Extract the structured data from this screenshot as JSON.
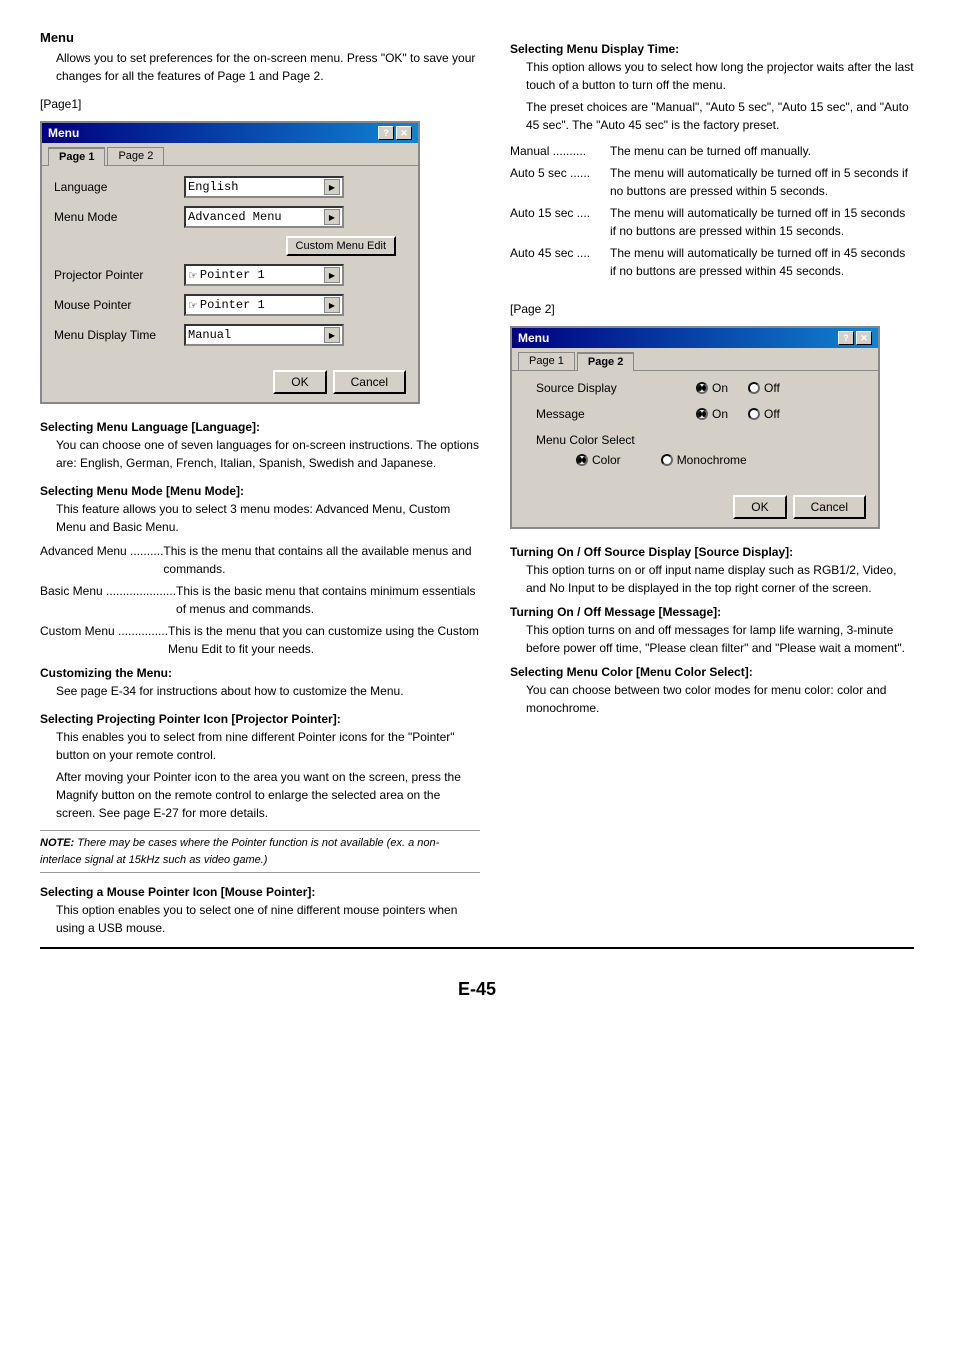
{
  "header": {
    "menu_heading": "Menu",
    "menu_desc": "Allows you to set preferences for the on-screen menu. Press \"OK\" to save your changes for all the features of Page 1 and Page 2.",
    "page1_label": "[Page1]",
    "page2_label": "[Page 2]"
  },
  "dialog1": {
    "title": "Menu",
    "tab1": "Page 1",
    "tab2": "Page 2",
    "rows": [
      {
        "label": "Language",
        "value": "English",
        "type": "select"
      },
      {
        "label": "Menu Mode",
        "value": "Advanced Menu",
        "type": "select"
      },
      {
        "label": "Projector Pointer",
        "value": "Pointer 1",
        "type": "select"
      },
      {
        "label": "Mouse Pointer",
        "value": "Pointer 1",
        "type": "select"
      },
      {
        "label": "Menu Display Time",
        "value": "Manual",
        "type": "select"
      }
    ],
    "custom_btn": "Custom Menu Edit",
    "ok_btn": "OK",
    "cancel_btn": "Cancel"
  },
  "dialog2": {
    "title": "Menu",
    "tab1": "Page 1",
    "tab2": "Page 2",
    "rows": [
      {
        "label": "Source Display",
        "on_selected": true,
        "off_selected": false
      },
      {
        "label": "Message",
        "on_selected": true,
        "off_selected": false
      }
    ],
    "color_label": "Menu Color Select",
    "color_selected": true,
    "mono_selected": false,
    "ok_btn": "OK",
    "cancel_btn": "Cancel"
  },
  "left_sections": [
    {
      "heading": "Selecting Menu Language [Language]:",
      "text": "You can choose one of seven languages for on-screen instructions. The options are: English, German, French, Italian, Spanish, Swedish and Japanese."
    },
    {
      "heading": "Selecting Menu Mode [Menu Mode]:",
      "text": "This feature allows you to select 3 menu modes: Advanced Menu, Custom Menu and Basic Menu."
    },
    {
      "defs": [
        {
          "term": "Advanced Menu ..........",
          "desc": "This is the menu that contains all the available menus and commands."
        },
        {
          "term": "Basic Menu ...................",
          "desc": "This is the basic menu that contains minimum essentials of menus and commands."
        },
        {
          "term": "Custom Menu ...............",
          "desc": "This is the menu that you can customize using the Custom Menu Edit to fit your needs."
        }
      ]
    },
    {
      "heading": "Customizing the Menu:",
      "text": "See page E-34 for instructions about how to customize the Menu."
    },
    {
      "heading": "Selecting Projecting Pointer Icon [Projector Pointer]:",
      "text1": "This enables you to select from nine different Pointer icons for the \"Pointer\" button on your remote control.",
      "text2": "After moving your Pointer icon to the area you want on the screen, press the Magnify button on the remote control to enlarge the selected area on the screen. See page E-27 for more details.",
      "note": "NOTE: There may be cases where the Pointer function is not available (ex. a non-interlace signal at 15kHz such as video game.)"
    },
    {
      "heading": "Selecting a Mouse Pointer Icon [Mouse Pointer]:",
      "text": "This option enables you to select one of nine different mouse pointers when using a USB mouse."
    }
  ],
  "right_top": {
    "heading": "Selecting Menu Display Time:",
    "text1": "This option allows you to select how long the projector waits after the last touch of a button to turn off the menu.",
    "text2": "The preset choices are \"Manual\", \"Auto 5 sec\", \"Auto 15 sec\", and \"Auto 45 sec\". The \"Auto 45 sec\" is the factory preset.",
    "defs": [
      {
        "term": "Manual ..........",
        "desc": "The menu can be turned off manually."
      },
      {
        "term": "Auto 5 sec ......",
        "desc": "The menu will automatically be turned off in 5 seconds if no buttons are pressed within 5 seconds."
      },
      {
        "term": "Auto 15 sec ....",
        "desc": "The menu will automatically be turned off in 15 seconds if no buttons are pressed within 15 seconds."
      },
      {
        "term": "Auto 45 sec ....",
        "desc": "The menu will automatically be turned off in 45 seconds if no buttons are pressed within 45 seconds."
      }
    ]
  },
  "right_bottom": [
    {
      "heading": "Turning On / Off Source Display [Source Display]:",
      "text": "This option turns on or off input name display such as RGB1/2, Video, and No Input to be displayed in the top right corner of the screen."
    },
    {
      "heading": "Turning On / Off Message [Message]:",
      "text": "This option turns on and off messages for lamp life warning, 3-minute before power off time, \"Please clean filter\" and \"Please wait a moment\"."
    },
    {
      "heading": "Selecting Menu Color [Menu Color Select]:",
      "text": "You can choose between two color modes for menu color: color and monochrome."
    }
  ],
  "footer": {
    "page_number": "E-45"
  }
}
